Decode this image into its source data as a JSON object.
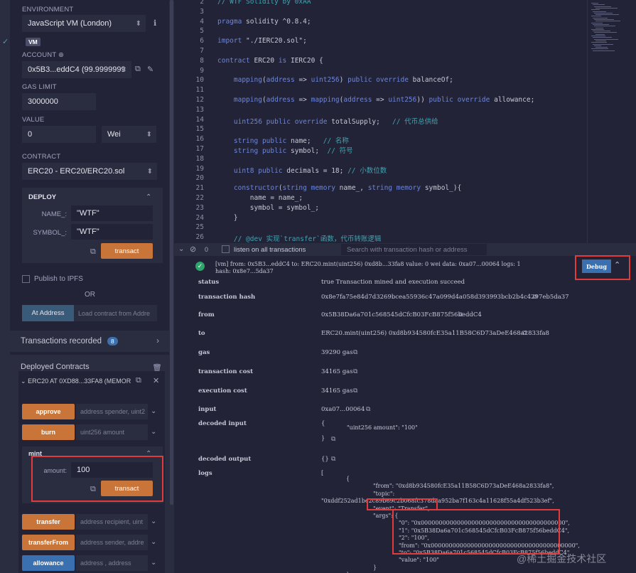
{
  "deploy": {
    "environment_label": "ENVIRONMENT",
    "environment_value": "JavaScript VM (London)",
    "vm_badge": "VM",
    "account_label": "ACCOUNT",
    "account_value": "0x5B3...eddC4 (99.9999999",
    "gas_limit_label": "GAS LIMIT",
    "gas_limit_value": "3000000",
    "value_label": "VALUE",
    "value_amount": "0",
    "value_unit": "Wei",
    "contract_label": "CONTRACT",
    "contract_value": "ERC20 - ERC20/ERC20.sol",
    "deploy_header": "DEPLOY",
    "name_label": "NAME_:",
    "name_value": "\"WTF\"",
    "symbol_label": "SYMBOL_:",
    "symbol_value": "\"WTF\"",
    "transact_label": "transact",
    "ipfs_label": "Publish to IPFS",
    "or_label": "OR",
    "at_address_label": "At Address",
    "load_placeholder": "Load contract from Addre"
  },
  "transactions": {
    "label": "Transactions recorded",
    "count": "8"
  },
  "deployed": {
    "label": "Deployed Contracts",
    "instance": "ERC20 AT 0XD88...33FA8 (MEMOR",
    "functions": [
      {
        "name": "approve",
        "placeholder": "address spender, uint2"
      },
      {
        "name": "burn",
        "placeholder": "uint256 amount"
      }
    ],
    "mint": {
      "name": "mint",
      "amount_label": "amount:",
      "amount_value": "100",
      "transact_label": "transact"
    },
    "functions2": [
      {
        "name": "transfer",
        "placeholder": "address recipient, uint"
      },
      {
        "name": "transferFrom",
        "placeholder": "address sender, addre"
      },
      {
        "name": "allowance",
        "placeholder": "address , address"
      }
    ]
  },
  "editor": {
    "lines": [
      {
        "n": "2",
        "t": "// WTF Solidity by 0xAA"
      },
      {
        "n": "3",
        "t": ""
      },
      {
        "n": "4",
        "t": "pragma solidity ^0.8.4;"
      },
      {
        "n": "5",
        "t": ""
      },
      {
        "n": "6",
        "t": "import \"./IERC20.sol\";"
      },
      {
        "n": "7",
        "t": ""
      },
      {
        "n": "8",
        "t": "contract ERC20 is IERC20 {"
      },
      {
        "n": "9",
        "t": ""
      },
      {
        "n": "10",
        "t": "    mapping(address => uint256) public override balanceOf;"
      },
      {
        "n": "11",
        "t": ""
      },
      {
        "n": "12",
        "t": "    mapping(address => mapping(address => uint256)) public override allowance;"
      },
      {
        "n": "13",
        "t": ""
      },
      {
        "n": "14",
        "t": "    uint256 public override totalSupply;   // 代币总供给"
      },
      {
        "n": "15",
        "t": ""
      },
      {
        "n": "16",
        "t": "    string public name;   // 名称"
      },
      {
        "n": "17",
        "t": "    string public symbol;  // 符号"
      },
      {
        "n": "18",
        "t": ""
      },
      {
        "n": "19",
        "t": "    uint8 public decimals = 18; // 小数位数"
      },
      {
        "n": "20",
        "t": ""
      },
      {
        "n": "21",
        "t": "    constructor(string memory name_, string memory symbol_){"
      },
      {
        "n": "22",
        "t": "        name = name_;"
      },
      {
        "n": "23",
        "t": "        symbol = symbol_;"
      },
      {
        "n": "24",
        "t": "    }"
      },
      {
        "n": "25",
        "t": ""
      },
      {
        "n": "26",
        "t": "    // @dev 实现`transfer`函数，代币转账逻辑"
      }
    ]
  },
  "terminal": {
    "count": "0",
    "listen_label": "listen on all transactions",
    "search_placeholder": "Search with transaction hash or address",
    "tx_summary_1": "[vm]  from: 0x5B3...eddC4 to: ERC20.mint(uint256) 0xd8b...33fa8 value: 0 wei data: 0xa07...00064 logs: 1",
    "tx_summary_2": "hash: 0x8e7...5da37",
    "debug_label": "Debug",
    "rows": [
      {
        "k": "status",
        "v": "true Transaction mined and execution succeed"
      },
      {
        "k": "transaction hash",
        "v": "0x8e7fa75e84d7d3269bcea55936c47a099d4a058d393993bcb2b4c4297eb5da37"
      },
      {
        "k": "from",
        "v": "0x5B38Da6a701c568545dCfcB03FcB875f56beddC4"
      },
      {
        "k": "to",
        "v": "ERC20.mint(uint256) 0xd8b934580fcE35a11B58C6D73aDeE468a2833fa8"
      },
      {
        "k": "gas",
        "v": "39290 gas"
      },
      {
        "k": "transaction cost",
        "v": "34165 gas"
      },
      {
        "k": "execution cost",
        "v": "34165 gas"
      },
      {
        "k": "input",
        "v": "0xa07...00064"
      },
      {
        "k": "decoded input",
        "v": "{"
      },
      {
        "k": "decoded output",
        "v": "{}"
      },
      {
        "k": "logs",
        "v": "["
      }
    ],
    "decoded_input_body": "\"uint256 amount\": \"100\"",
    "decoded_input_close": "}",
    "logs_lines": [
      "{",
      "\"from\": \"0xd8b934580fcE35a11B58C6D73aDeE468a2833fa8\",",
      "\"topic\":",
      "\"0xddf252ad1be2c89b69c2b068fc378daa952ba7f163c4a11628f55a4df523b3ef\",",
      "\"event\": \"Transfer\",",
      "\"args\": {",
      "\"0\": \"0x0000000000000000000000000000000000000000\",",
      "\"1\": \"0x5B38Da6a701c568545dCfcB03FcB875f56beddC4\",",
      "\"2\": \"100\",",
      "\"from\": \"0x0000000000000000000000000000000000000000\",",
      "\"to\": \"0x5B38Da6a701c568545dCfcB03FcB875f56beddC4\",",
      "\"value\": \"100\"",
      "}",
      "}",
      "]"
    ],
    "watermark": "@稀土掘金技术社区"
  }
}
